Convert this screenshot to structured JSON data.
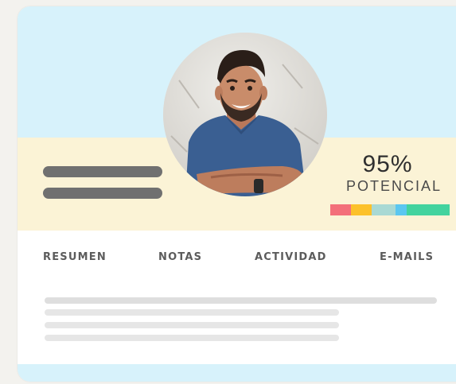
{
  "profile": {
    "potential_value": "95%",
    "potential_label": "POTENCIAL",
    "score_colors": [
      "#f36f7a",
      "#fcc12b",
      "#a9d9d4",
      "#5bc7f0",
      "#43d39e"
    ]
  },
  "tabs": [
    {
      "label": "RESUMEN"
    },
    {
      "label": "NOTAS"
    },
    {
      "label": "ACTIVIDAD"
    },
    {
      "label": "E-MAILS"
    }
  ],
  "colors": {
    "header_blue": "#d7f2fb",
    "header_cream": "#fbf3d6",
    "text_dark": "#2f2f2f",
    "placeholder_gray": "#707070"
  },
  "icons": {
    "avatar": "person-photo-icon"
  }
}
